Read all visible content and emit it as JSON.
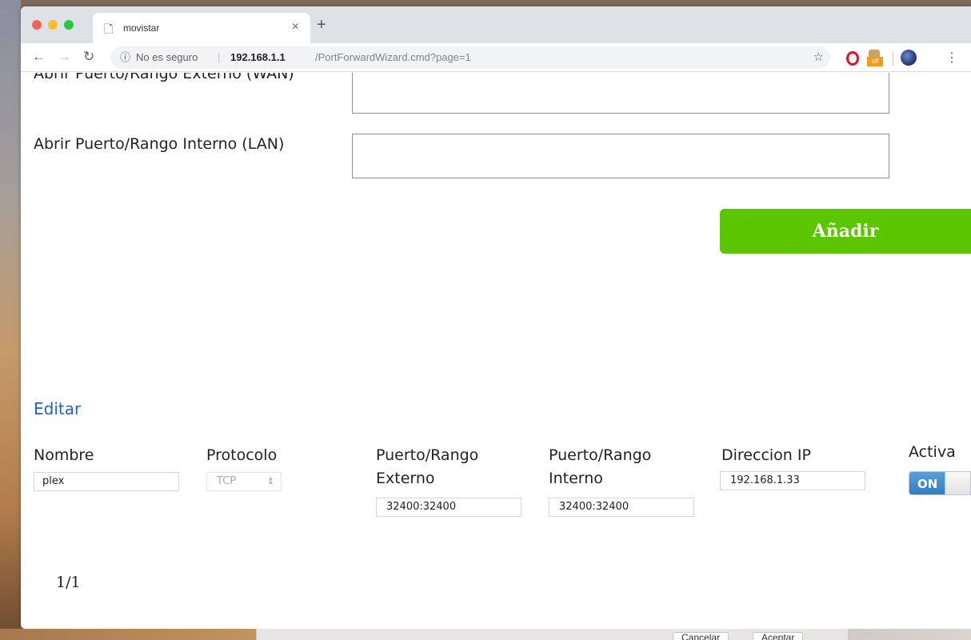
{
  "browser": {
    "tab_title": "movistar",
    "new_tab_symbol": "+",
    "close_symbol": "×",
    "address": {
      "security_label": "No es seguro",
      "separator": "|",
      "host": "192.168.1.1",
      "path": "/PortForwardWizard.cmd?page=1"
    },
    "extensions": {
      "off_label": "off"
    }
  },
  "form": {
    "external_label": "Abrir Puerto/Rango Externo (WAN)",
    "internal_label": "Abrir Puerto/Rango Interno (LAN)",
    "add_button_label": "Añadir"
  },
  "edit": {
    "heading": "Editar",
    "columns": {
      "nombre": "Nombre",
      "protocolo": "Protocolo",
      "externo": "Puerto/Rango Externo",
      "interno": "Puerto/Rango Interno",
      "ip": "Direccion IP",
      "activa": "Activa"
    },
    "row": {
      "nombre": "plex",
      "protocolo": "TCP",
      "externo": "32400:32400",
      "interno": "32400:32400",
      "ip": "192.168.1.33",
      "toggle_label": "ON"
    }
  },
  "pagination": "1/1",
  "background_dialog": {
    "cancel_label": "Cancelar",
    "accept_label": "Aceptar"
  },
  "colors": {
    "accent_green": "#5bc500",
    "link_blue": "#1a62c7",
    "toggle_blue": "#2f7bc2"
  }
}
